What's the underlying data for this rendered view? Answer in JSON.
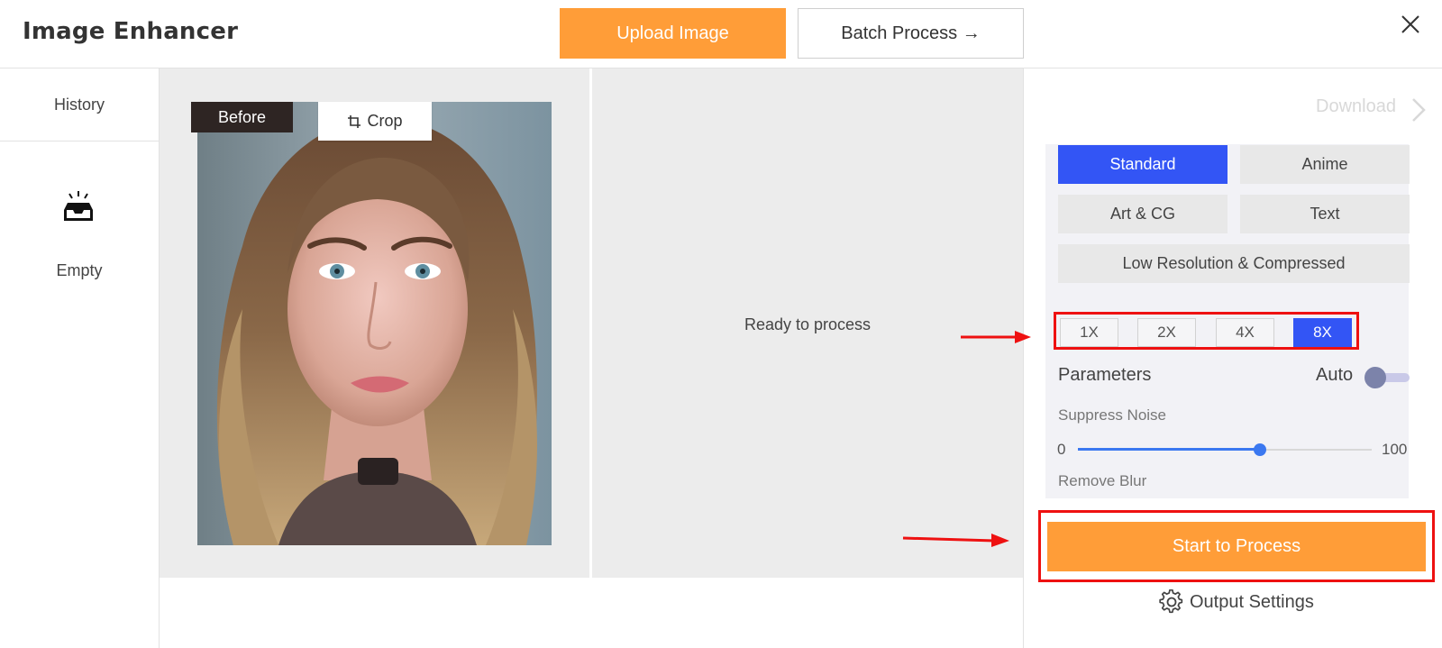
{
  "header": {
    "title": "Image Enhancer",
    "upload_label": "Upload Image",
    "batch_label": "Batch Process →"
  },
  "sidebar": {
    "history_label": "History",
    "empty_label": "Empty"
  },
  "preview": {
    "before_label": "Before",
    "crop_label": "Crop",
    "status_text": "Ready to process"
  },
  "panel": {
    "download_label": "Download",
    "modes": [
      {
        "label": "Standard",
        "active": true
      },
      {
        "label": "Anime",
        "active": false
      },
      {
        "label": "Art & CG",
        "active": false
      },
      {
        "label": "Text",
        "active": false
      },
      {
        "label": "Low Resolution & Compressed",
        "active": false
      }
    ],
    "scales": [
      {
        "label": "1X",
        "active": false
      },
      {
        "label": "2X",
        "active": false
      },
      {
        "label": "4X",
        "active": false
      },
      {
        "label": "8X",
        "active": true
      }
    ],
    "parameters_label": "Parameters",
    "auto_label": "Auto",
    "auto_on": false,
    "suppress_noise_label": "Suppress Noise",
    "suppress_noise": {
      "min": "0",
      "max": "100",
      "value": 62
    },
    "remove_blur_label": "Remove Blur",
    "start_label": "Start to Process",
    "output_settings_label": "Output Settings"
  },
  "colors": {
    "accent_orange": "#ff9d38",
    "accent_blue": "#3355f5",
    "highlight_red": "#ee1111"
  },
  "icons": {
    "close": "close-icon",
    "empty_inbox": "inbox-icon",
    "crop": "crop-icon",
    "download_chevron": "chevron-right-icon",
    "output_settings": "gear-icon"
  }
}
